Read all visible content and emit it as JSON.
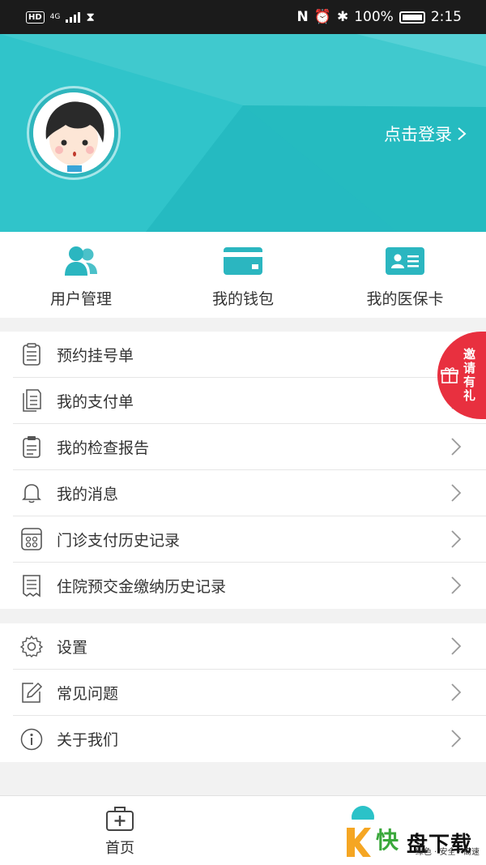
{
  "status_bar": {
    "hd": "HD",
    "network": "4G",
    "battery": "100%",
    "time": "2:15"
  },
  "header": {
    "login_text": "点击登录"
  },
  "quick_actions": [
    {
      "label": "用户管理",
      "icon": "users-icon"
    },
    {
      "label": "我的钱包",
      "icon": "wallet-card-icon"
    },
    {
      "label": "我的医保卡",
      "icon": "id-card-icon"
    }
  ],
  "menu_group_1": [
    {
      "label": "预约挂号单",
      "icon": "clipboard-list-icon"
    },
    {
      "label": "我的支付单",
      "icon": "document-icon"
    },
    {
      "label": "我的检查报告",
      "icon": "report-icon"
    },
    {
      "label": "我的消息",
      "icon": "bell-icon"
    },
    {
      "label": "门诊支付历史记录",
      "icon": "calculator-icon"
    },
    {
      "label": "住院预交金缴纳历史记录",
      "icon": "receipt-icon"
    }
  ],
  "menu_group_2": [
    {
      "label": "设置",
      "icon": "gear-icon"
    },
    {
      "label": "常见问题",
      "icon": "edit-icon"
    },
    {
      "label": "关于我们",
      "icon": "info-icon"
    }
  ],
  "invite_badge": {
    "text": "邀请有礼",
    "icon": "gift-icon",
    "color": "#e8303f"
  },
  "tab_bar": {
    "home_label": "首页"
  },
  "watermark": {
    "brand_prefix": "快",
    "brand": "盘下载",
    "tagline": "绿色 · 安全 · 高速"
  },
  "colors": {
    "accent": "#2bc2c8",
    "invite": "#e8303f",
    "text": "#333333"
  }
}
